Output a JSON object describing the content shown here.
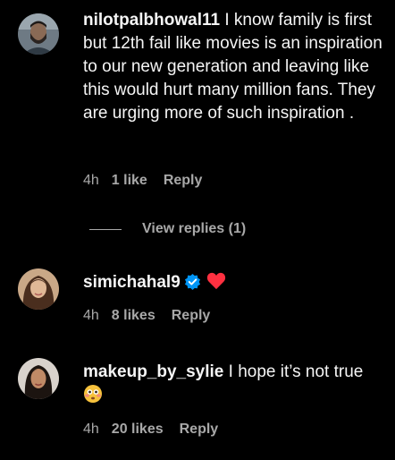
{
  "comments": [
    {
      "username": "nilotpalbhowal11",
      "text": " I know family is first but 12th fail like movies is an inspiration to our new generation and leaving like this would hurt many million fans. They are urging more of such inspiration .",
      "time": "4h",
      "likes": "1 like",
      "reply_label": "Reply",
      "avatar_icon": "bearded-man-avatar"
    },
    {
      "username": "simichahal9",
      "text": "",
      "verified": true,
      "reaction_icon": "red-heart-icon",
      "time": "4h",
      "likes": "8 likes",
      "reply_label": "Reply",
      "avatar_icon": "woman-avatar"
    },
    {
      "username": "makeup_by_sylie",
      "text": " I hope it’s not true",
      "reaction_icon": "flushed-face-icon",
      "time": "4h",
      "likes": "20 likes",
      "reply_label": "Reply",
      "avatar_icon": "woman-avatar-dark-hair"
    }
  ],
  "view_replies_label": "View replies (1)",
  "colors": {
    "background": "#000000",
    "text_primary": "#f5f5f5",
    "text_secondary": "#a8a8a8",
    "verified_blue": "#0095f6",
    "heart_red": "#ff3040"
  }
}
